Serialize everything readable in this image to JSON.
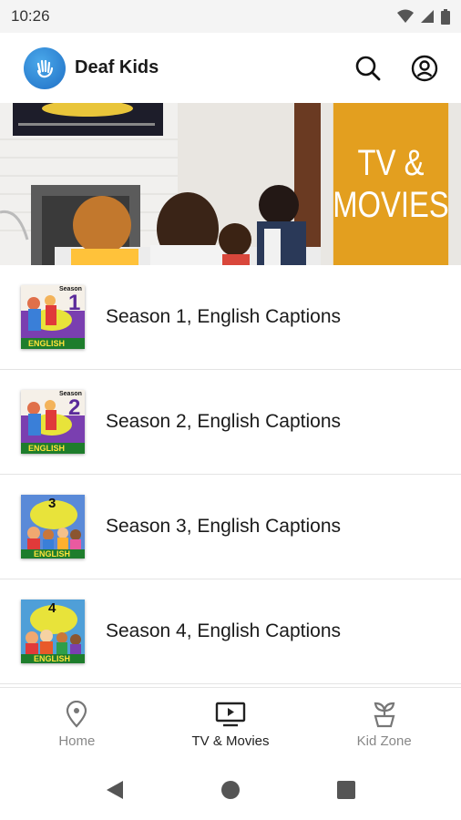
{
  "status_bar": {
    "time": "10:26"
  },
  "app_bar": {
    "title": "Deaf Kids"
  },
  "hero": {
    "label_line1": "TV &",
    "label_line2": "MOVIES"
  },
  "seasons": [
    {
      "label": "Season 1, English Captions",
      "badge": "1",
      "badge_caption": "Season",
      "thumb_caption": "ENGLISH"
    },
    {
      "label": "Season 2, English Captions",
      "badge": "2",
      "badge_caption": "Season",
      "thumb_caption": "ENGLISH"
    },
    {
      "label": "Season 3, English Captions",
      "badge": "3",
      "badge_caption": "",
      "thumb_caption": "ENGLISH"
    },
    {
      "label": "Season 4, English Captions",
      "badge": "4",
      "badge_caption": "",
      "thumb_caption": "ENGLISH"
    }
  ],
  "bottom_nav": [
    {
      "label": "Home",
      "active": false
    },
    {
      "label": "TV & Movies",
      "active": true
    },
    {
      "label": "Kid Zone",
      "active": false
    }
  ]
}
